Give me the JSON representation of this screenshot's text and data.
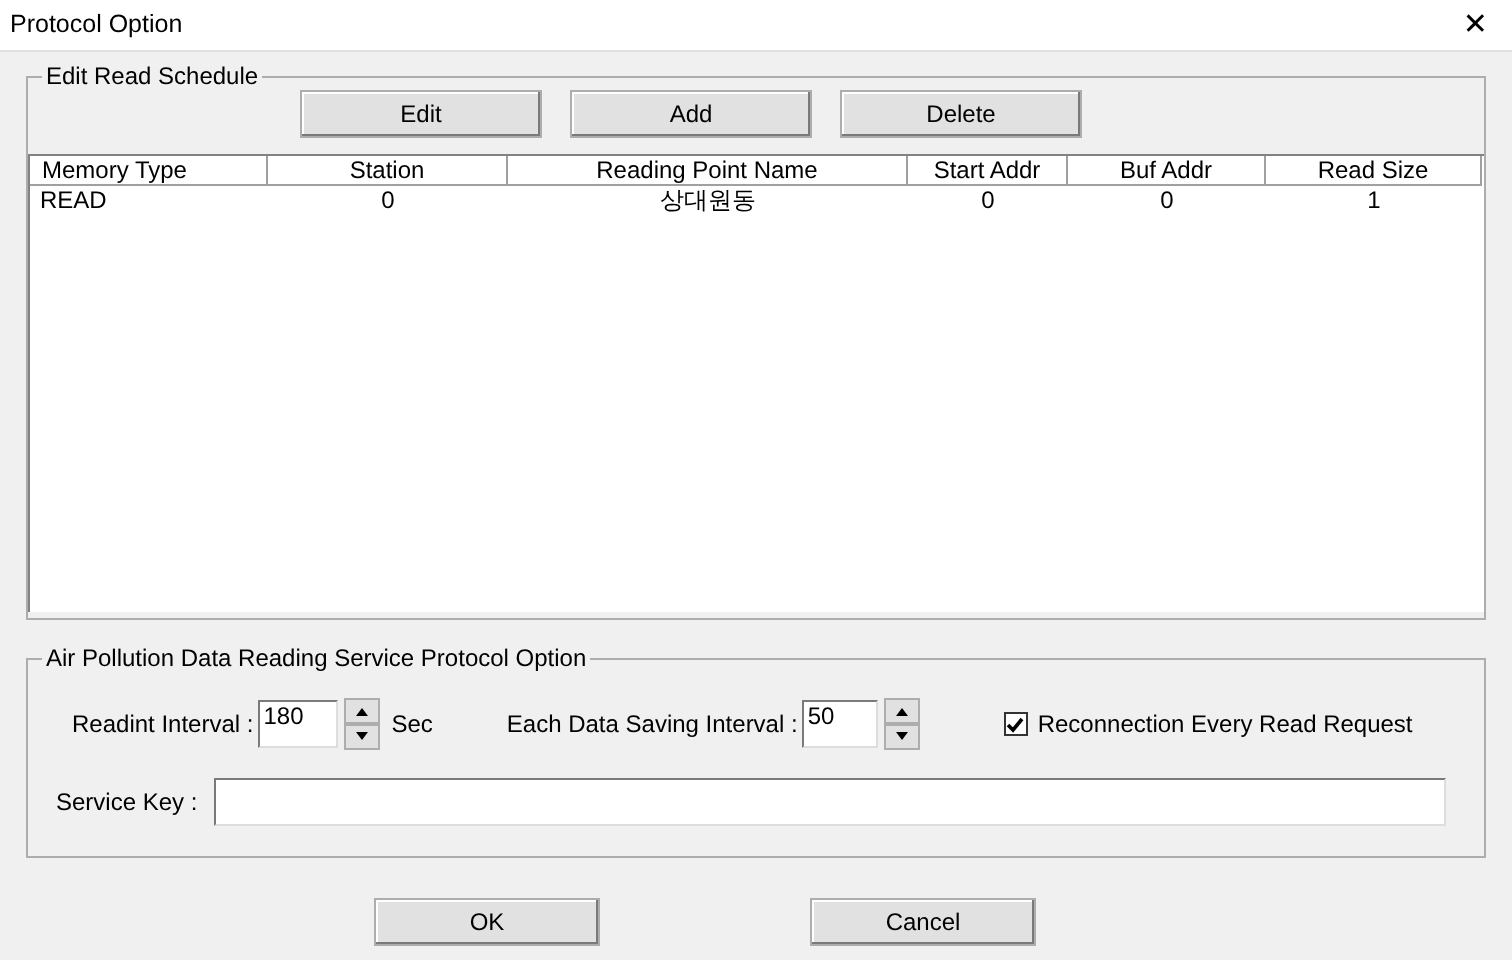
{
  "window": {
    "title": "Protocol Option",
    "close": "✕"
  },
  "schedule": {
    "title": "Edit Read Schedule",
    "buttons": [
      "Edit",
      "Add",
      "Delete"
    ],
    "columns": [
      "Memory Type",
      "Station",
      "Reading Point Name",
      "Start Addr",
      "Buf Addr",
      "Read Size"
    ],
    "rows": [
      {
        "cells": [
          "READ",
          "0",
          "상대원동",
          "0",
          "0",
          "1"
        ],
        "selected": false
      }
    ]
  },
  "option": {
    "title": "Air Pollution Data Reading Service Protocol Option",
    "read_interval": {
      "label": "Readint Interval :",
      "value": "180",
      "unit": "Sec"
    },
    "save_interval": {
      "label": "Each Data Saving Interval :",
      "value": "50"
    },
    "reconnect": {
      "label": "Reconnection Every Read Request",
      "checked": true
    },
    "service_key": {
      "label": "Service Key :"
    }
  },
  "buttons": [
    "OK",
    "Cancel"
  ]
}
